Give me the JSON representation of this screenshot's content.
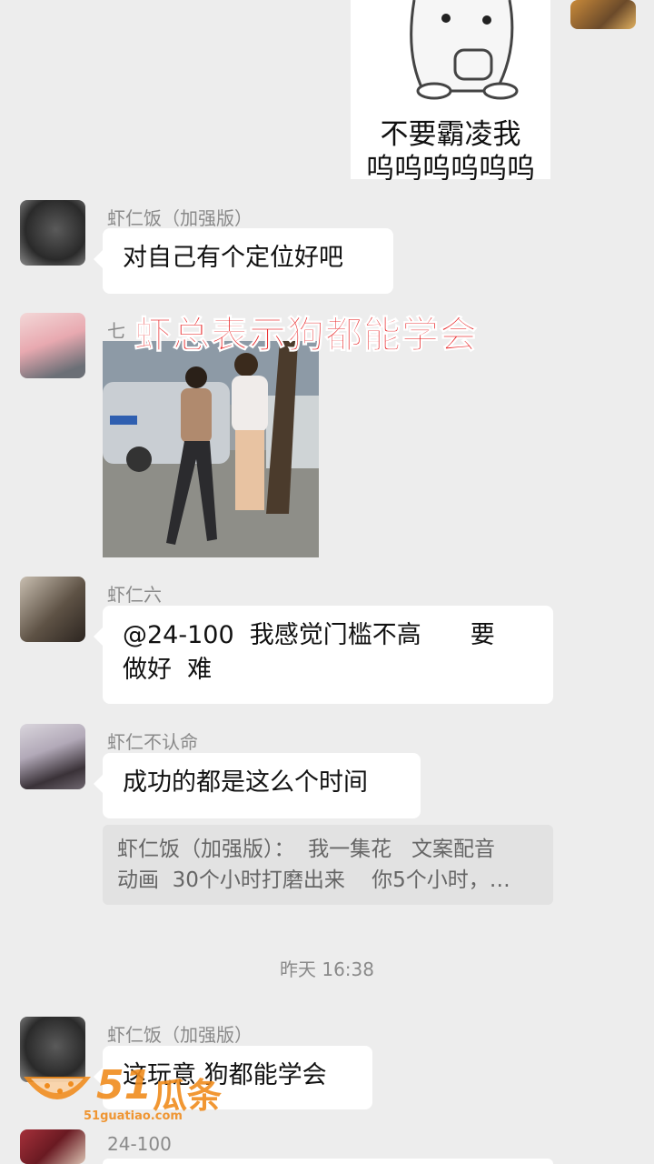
{
  "sticker_top": {
    "line1": "不要霸凌我",
    "line2": "呜呜呜呜呜呜"
  },
  "overlay_caption": "虾总表示狗都能学会",
  "messages": [
    {
      "sender": "虾仁饭（加强版）",
      "text": "对自己有个定位好吧"
    },
    {
      "sender": "七"
    },
    {
      "sender": "虾仁六",
      "line1": "@24-100  我感觉门槛不高　　要",
      "line2": "做好  难"
    },
    {
      "sender": "虾仁不认命",
      "text": "成功的都是这么个时间",
      "quote_line1": "虾仁饭（加强版）：  我一集花   文案配音",
      "quote_line2": "动画  30个小时打磨出来    你5个小时，…"
    },
    {
      "sender": "虾仁饭（加强版）",
      "text": "这玩意 狗都能学会"
    },
    {
      "sender": "24-100"
    }
  ],
  "timestamp": "昨天 16:38",
  "watermark": {
    "brand_digits": "51",
    "brand_chars": "瓜条",
    "url": "51guatiao.com"
  },
  "colors": {
    "background": "#ededed",
    "bubble": "#ffffff",
    "caption_red": "#e8282a",
    "watermark_orange": "#f08c1e"
  }
}
